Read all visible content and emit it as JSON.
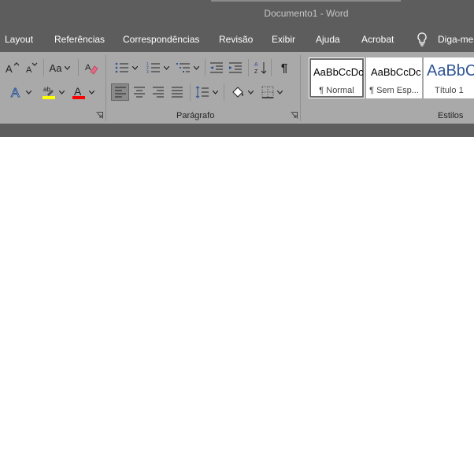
{
  "window": {
    "title": "Documento1  -  Word"
  },
  "tabs": [
    {
      "label": "Layout"
    },
    {
      "label": "Referências"
    },
    {
      "label": "Correspondências"
    },
    {
      "label": "Revisão"
    },
    {
      "label": "Exibir"
    },
    {
      "label": "Ajuda"
    },
    {
      "label": "Acrobat"
    }
  ],
  "tell_me": {
    "label": "Diga-me"
  },
  "font_group": {
    "change_case_label": "Aa"
  },
  "paragraph_group": {
    "label": "Parágrafo"
  },
  "styles_group": {
    "label": "Estilos",
    "styles": [
      {
        "sample": "AaBbCcDc",
        "name": "¶ Normal",
        "selected": true
      },
      {
        "sample": "AaBbCcDc",
        "name": "¶ Sem Esp...",
        "selected": false
      },
      {
        "sample": "AaBbCc",
        "name": "Título 1",
        "selected": false
      }
    ]
  },
  "colors": {
    "title_bar": "#5d5d5d",
    "ribbon": "#a9a9a9",
    "highlight_yellow": "#ffff00",
    "font_color_red": "#ff0000",
    "heading_blue": "#2f5496",
    "selected_button": "#8a8a8a"
  }
}
